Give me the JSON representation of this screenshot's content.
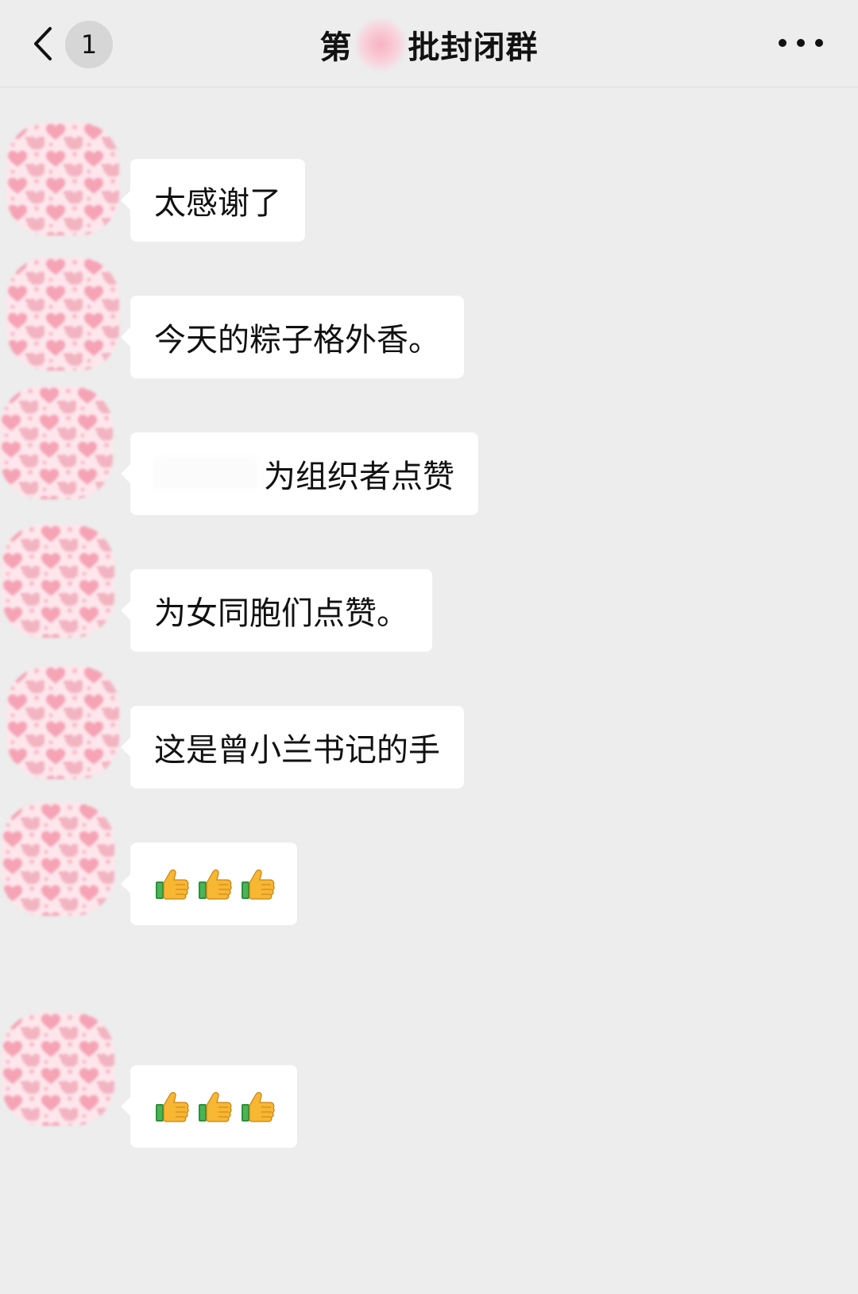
{
  "header": {
    "unread_count": "1",
    "title_prefix": "第",
    "title_suffix": "批封闭群",
    "subtitle": ""
  },
  "messages": [
    {
      "text": "太感谢了"
    },
    {
      "text": "今天的粽子格外香。"
    },
    {
      "text": "为组织者点赞"
    },
    {
      "text": "为女同胞们点赞。"
    },
    {
      "text": "这是曾小兰书记的手"
    },
    {
      "emoji": "thumbs-up",
      "count": 3
    },
    {
      "emoji": "thumbs-up",
      "count": 3
    }
  ],
  "colors": {
    "background": "#ededed",
    "bubble": "#ffffff",
    "avatar_heart": "#f6a6b6",
    "avatar_bg": "#fde7ec"
  }
}
